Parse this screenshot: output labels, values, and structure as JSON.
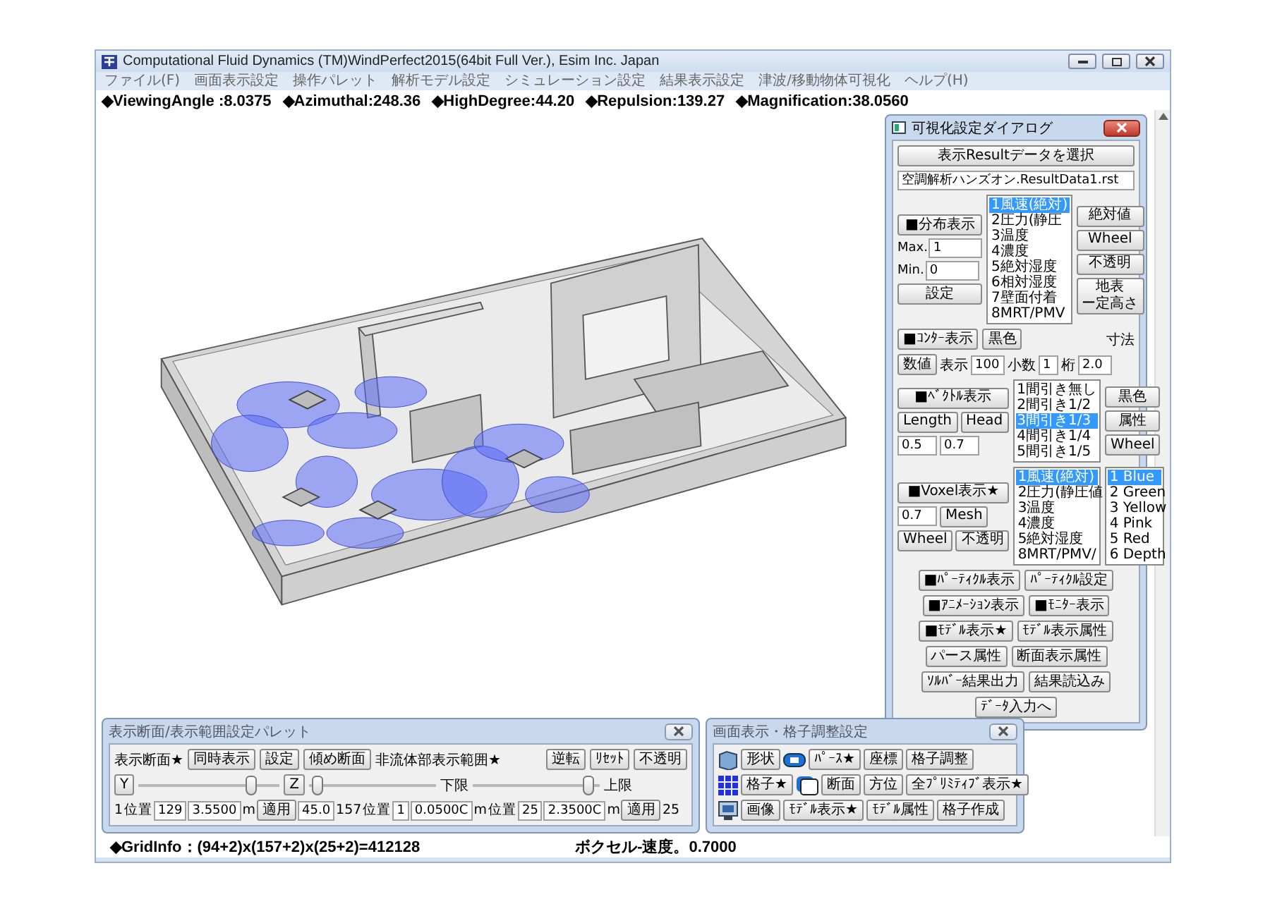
{
  "window": {
    "title": "Computational Fluid Dynamics (TM)WindPerfect2015(64bit Full Ver.), Esim Inc. Japan"
  },
  "menu": [
    "ファイル(F)",
    "画面表示設定",
    "操作パレット",
    "解析モデル設定",
    "シミュレーション設定",
    "結果表示設定",
    "津波/移動物体可視化",
    "ヘルプ(H)"
  ],
  "view_info": [
    "◆ViewingAngle :8.0375",
    "◆Azimuthal:248.36",
    "◆HighDegree:44.20",
    "◆Repulsion:139.27",
    "◆Magnification:38.0560"
  ],
  "dialog": {
    "title": "可視化設定ダイアログ",
    "select_button": "表示Resultデータを選択",
    "file": "空調解析ハンズオン.ResultData1.rst",
    "distribution": {
      "toggle": "■分布表示",
      "max_label": "Max.",
      "max": "1",
      "min_label": "Min.",
      "min": "0",
      "set_button": "設定",
      "list": [
        {
          "label": "1風速(絶対)",
          "selected": true
        },
        {
          "label": "2圧力(静圧",
          "selected": false
        },
        {
          "label": "3温度",
          "selected": false
        },
        {
          "label": "4濃度",
          "selected": false
        },
        {
          "label": "5絶対湿度",
          "selected": false
        },
        {
          "label": "6相対湿度",
          "selected": false
        },
        {
          "label": "7壁面付着",
          "selected": false
        },
        {
          "label": "8MRT/PMV",
          "selected": false
        }
      ],
      "buttons": [
        "絶対値",
        "Wheel",
        "不透明",
        "地表ー定高さ"
      ]
    },
    "contour": {
      "toggle": "■ｺﾝﾀｰ表示",
      "color_button": "黒色",
      "size_label": "寸法",
      "value_button": "数値",
      "display_label": "表示",
      "display": "100",
      "decimal_label": "小数",
      "decimal": "1",
      "digits_label": "桁",
      "size": "2.0"
    },
    "vector": {
      "toggle": "■ﾍﾞｸﾄﾙ表示",
      "length_button": "Length",
      "head_button": "Head",
      "length": "0.5",
      "head": "0.7",
      "list": [
        {
          "label": "1間引き無し",
          "selected": false
        },
        {
          "label": "2間引き1/2",
          "selected": false
        },
        {
          "label": "3間引き1/3",
          "selected": true
        },
        {
          "label": "4間引き1/4",
          "selected": false
        },
        {
          "label": "5間引き1/5",
          "selected": false
        }
      ],
      "buttons": [
        "黒色",
        "属性",
        "Wheel"
      ]
    },
    "voxel": {
      "toggle": "■Voxel表示★",
      "value": "0.7",
      "mesh_button": "Mesh",
      "wheel_button": "Wheel",
      "opacity_button": "不透明",
      "list": [
        {
          "label": "1風速(絶対)",
          "selected": true
        },
        {
          "label": "2圧力(静圧値",
          "selected": false
        },
        {
          "label": "3温度",
          "selected": false
        },
        {
          "label": "4濃度",
          "selected": false
        },
        {
          "label": "5絶対湿度",
          "selected": false
        },
        {
          "label": "8MRT/PMV/",
          "selected": false
        }
      ],
      "colors": [
        {
          "label": "1 Blue",
          "selected": true
        },
        {
          "label": "2 Green",
          "selected": false
        },
        {
          "label": "3 Yellow",
          "selected": false
        },
        {
          "label": "4 Pink",
          "selected": false
        },
        {
          "label": "5 Red",
          "selected": false
        },
        {
          "label": "6 Depth",
          "selected": false
        }
      ]
    },
    "buttons": [
      [
        "■ﾊﾟｰﾃｨｸﾙ表示",
        "ﾊﾟｰﾃｨｸﾙ設定"
      ],
      [
        "■ｱﾆﾒｰｼｮﾝ表示",
        "■ﾓﾆﾀｰ表示"
      ],
      [
        "■ﾓﾃﾞﾙ表示★",
        "ﾓﾃﾞﾙ表示属性"
      ],
      [
        "パース属性",
        "断面表示属性"
      ],
      [
        "ｿﾙﾊﾞｰ結果出力",
        "結果読込み"
      ],
      [
        "ﾃﾞｰﾀ入力へ"
      ]
    ]
  },
  "section_palette": {
    "title": "表示断面/表示範囲設定パレット",
    "section_label": "表示断面★",
    "buttons": [
      "同時表示",
      "設定",
      "傾め断面"
    ],
    "range_label": "非流体部表示範囲★",
    "range_buttons": [
      "逆転",
      "ﾘｾｯﾄ",
      "不透明"
    ],
    "lower_label": "下限",
    "upper_label": "上限",
    "sliders": [
      {
        "button": "Y",
        "level": 0.82
      },
      {
        "button": "Z",
        "level": 0.02
      },
      {
        "level": 0.95
      }
    ],
    "row": [
      {
        "kind": "text",
        "text": "1"
      },
      {
        "kind": "text",
        "text": "位置"
      },
      {
        "kind": "field",
        "text": "129"
      },
      {
        "kind": "field",
        "text": "3.5500"
      },
      {
        "kind": "text",
        "text": "m"
      },
      {
        "kind": "button",
        "text": "適用"
      },
      {
        "kind": "field",
        "text": "45.0"
      },
      {
        "kind": "text",
        "text": "157"
      },
      {
        "kind": "text",
        "text": "位置"
      },
      {
        "kind": "field",
        "text": "1"
      },
      {
        "kind": "field",
        "text": "0.0500C"
      },
      {
        "kind": "text",
        "text": "m"
      },
      {
        "kind": "text",
        "text": "位置"
      },
      {
        "kind": "field",
        "text": "25"
      },
      {
        "kind": "field",
        "text": "2.3500C"
      },
      {
        "kind": "text",
        "text": "m"
      },
      {
        "kind": "button",
        "text": "適用"
      },
      {
        "kind": "text",
        "text": "25"
      }
    ]
  },
  "grid_palette": {
    "title": "画面表示・格子調整設定",
    "rows": [
      [
        "形状",
        "ﾊﾟｰｽ★",
        "座標",
        "格子調整"
      ],
      [
        "格子★",
        "断面",
        "方位",
        "全ﾌﾟﾘﾐﾃｨﾌﾞ表示★"
      ],
      [
        "画像",
        "ﾓﾃﾞﾙ表示★",
        "ﾓﾃﾞﾙ属性",
        "格子作成"
      ]
    ]
  },
  "status_bar": [
    "◆GridInfo：(94+2)x(157+2)x(25+2)=412128",
    "ボクセル-速度。0.7000"
  ]
}
